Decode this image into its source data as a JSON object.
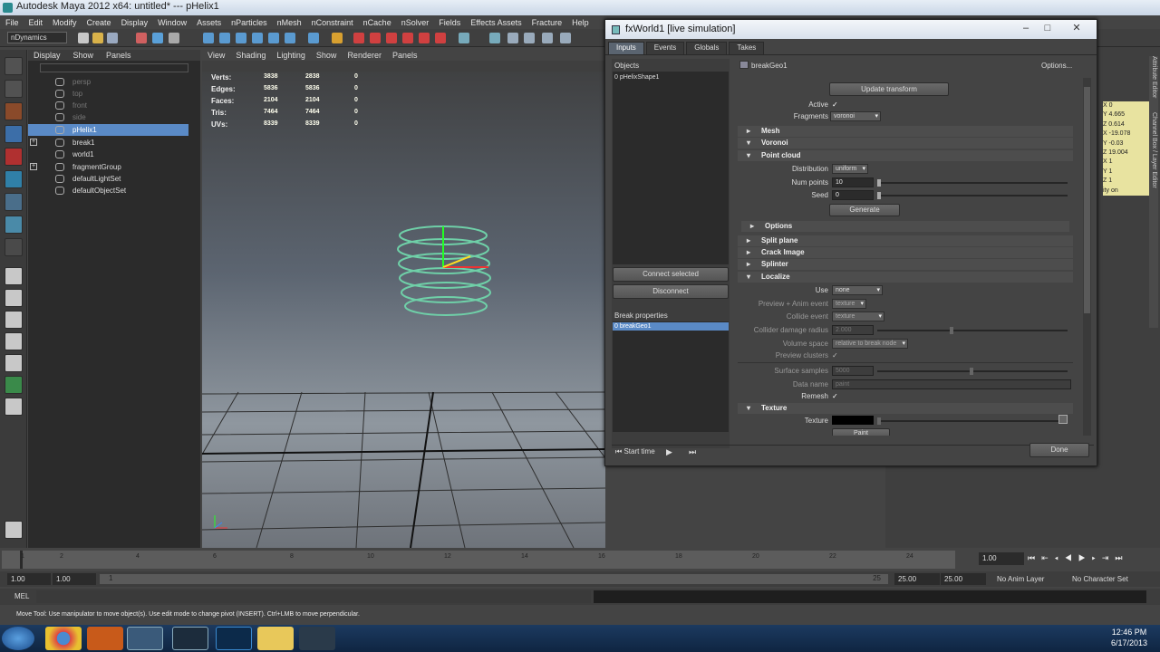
{
  "window": {
    "title": "Autodesk Maya 2012 x64: untitled*  ---  pHelix1"
  },
  "menubar": [
    "File",
    "Edit",
    "Modify",
    "Create",
    "Display",
    "Window",
    "Assets",
    "nParticles",
    "nMesh",
    "nConstraint",
    "nCache",
    "nSolver",
    "Fields",
    "Effects Assets",
    "Fracture",
    "Help"
  ],
  "shelf": {
    "menu_set": "nDynamics"
  },
  "outliner": {
    "menu": [
      "Display",
      "Show",
      "Panels"
    ],
    "items": [
      {
        "label": "persp",
        "state": "dim"
      },
      {
        "label": "top",
        "state": "dim"
      },
      {
        "label": "front",
        "state": "dim"
      },
      {
        "label": "side",
        "state": "dim"
      },
      {
        "label": "pHelix1",
        "state": "sel"
      },
      {
        "label": "break1",
        "state": "plus"
      },
      {
        "label": "world1",
        "state": ""
      },
      {
        "label": "fragmentGroup",
        "state": "plus"
      },
      {
        "label": "defaultLightSet",
        "state": ""
      },
      {
        "label": "defaultObjectSet",
        "state": ""
      }
    ]
  },
  "viewport": {
    "menu": [
      "View",
      "Shading",
      "Lighting",
      "Show",
      "Renderer",
      "Panels"
    ],
    "hud": [
      {
        "label": "Verts:",
        "v1": "3838",
        "v2": "2838",
        "v3": "0"
      },
      {
        "label": "Edges:",
        "v1": "5836",
        "v2": "5836",
        "v3": "0"
      },
      {
        "label": "Faces:",
        "v1": "2104",
        "v2": "2104",
        "v3": "0"
      },
      {
        "label": "Tris:",
        "v1": "7464",
        "v2": "7464",
        "v3": "0"
      },
      {
        "label": "UVs:",
        "v1": "8339",
        "v2": "8339",
        "v3": "0"
      }
    ]
  },
  "channel_box": {
    "rows": [
      {
        "label": "X",
        "value": "0"
      },
      {
        "label": "Y",
        "value": "4.665"
      },
      {
        "label": "Z",
        "value": "0.614"
      },
      {
        "label": "X",
        "value": "-19.078"
      },
      {
        "label": "Y",
        "value": "-0.03"
      },
      {
        "label": "Z",
        "value": "19.004"
      },
      {
        "label": "X",
        "value": "1"
      },
      {
        "label": "Y",
        "value": "1"
      },
      {
        "label": "Z",
        "value": "1"
      },
      {
        "label": "ity",
        "value": "on"
      }
    ],
    "side_tabs": [
      "Attribute Editor",
      "Channel Box / Layer Editor"
    ]
  },
  "dialog": {
    "title": "fxWorld1   [live simulation]",
    "tabs": [
      "Inputs",
      "Events",
      "Globals",
      "Takes"
    ],
    "objects_label": "Objects",
    "objects": [
      "0 pHelixShape1"
    ],
    "connect_selected": "Connect selected",
    "disconnect": "Disconnect",
    "break_properties_label": "Break properties",
    "break_properties": [
      "0 breakGeo1"
    ],
    "node_name": "breakGeo1",
    "options_menu": "Options...",
    "update_transform": "Update transform",
    "active_label": "Active",
    "active_checked": true,
    "fragments_label": "Fragments",
    "fragments_value": "voronoi",
    "sections": {
      "mesh": "Mesh",
      "voronoi": "Voronoi",
      "point_cloud": "Point cloud",
      "options": "Options",
      "split_plane": "Split plane",
      "crack_image": "Crack Image",
      "splinter": "Splinter",
      "localize": "Localize",
      "texture": "Texture"
    },
    "distribution_label": "Distribution",
    "distribution_value": "uniform",
    "num_points_label": "Num points",
    "num_points_value": "10",
    "seed_label": "Seed",
    "seed_value": "0",
    "generate": "Generate",
    "use_label": "Use",
    "use_value": "none",
    "preview_anim_label": "Preview + Anim event",
    "preview_anim_value": "texture",
    "collide_event_label": "Collide event",
    "collide_event_value": "texture",
    "collider_radius_label": "Collider damage radius",
    "collider_radius_value": "2.000",
    "volume_space_label": "Volume space",
    "volume_space_value": "relative to break node",
    "preview_clusters_label": "Preview clusters",
    "surface_samples_label": "Surface samples",
    "surface_samples_value": "5000",
    "data_name_label": "Data name",
    "data_name_value": "paint",
    "remesh_label": "Remesh",
    "texture_label": "Texture",
    "paint_label": "Paint",
    "start_time": "Start time",
    "done": "Done"
  },
  "timeline": {
    "ticks": [
      "1",
      "2",
      "4",
      "6",
      "8",
      "10",
      "12",
      "14",
      "16",
      "18",
      "20",
      "22",
      "24"
    ],
    "current_frame": "1.00",
    "markers_right": [
      "25"
    ]
  },
  "range": {
    "start": "1.00",
    "start_inner": "1.00",
    "slider_start": "1",
    "slider_end": "25",
    "end_inner": "25.00",
    "end": "25.00",
    "anim_layer": "No Anim Layer",
    "character_set": "No Character Set"
  },
  "command_line": {
    "label": "MEL"
  },
  "help_line": "Move Tool: Use manipulator to move object(s). Use edit mode to change pivot (INSERT).  Ctrl+LMB to move perpendicular.",
  "taskbar": {
    "time": "12:46 PM",
    "date": "6/17/2013"
  },
  "colors": {
    "selection": "#5a8ac6",
    "helix": "#6fd0a8",
    "maya_bg": "#444444",
    "taskbar": "#1c3a60"
  }
}
